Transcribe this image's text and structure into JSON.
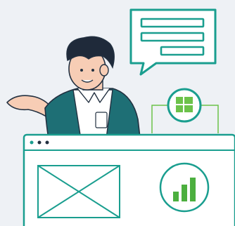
{
  "colors": {
    "background": "#eef1f5",
    "accent_teal": "#1a9e8f",
    "accent_green": "#6cc24a",
    "chart_green": "#4caf3f",
    "jacket": "#1e6f75",
    "skin": "#f7cdb5",
    "hair": "#1f2a3a",
    "shirt": "#ffffff",
    "outline": "#223040"
  },
  "icons": {
    "chat_bubble": "chat-bubble-icon",
    "windows_logo": "windows-logo-icon",
    "image_placeholder": "image-placeholder-icon",
    "bar_chart": "bar-chart-icon"
  },
  "browser": {
    "dots": [
      "dot-1",
      "dot-2",
      "dot-3"
    ]
  },
  "chart_icon_data": {
    "values": [
      0.35,
      0.6,
      0.85
    ]
  }
}
